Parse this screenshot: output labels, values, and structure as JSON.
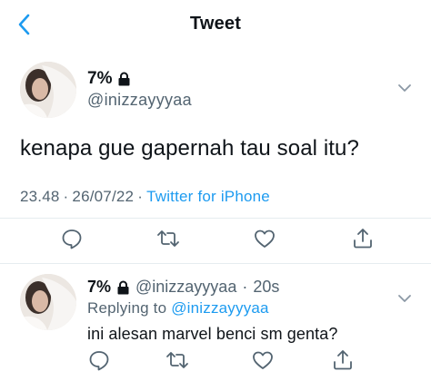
{
  "header": {
    "title": "Tweet"
  },
  "tweet": {
    "author_name": "7%",
    "author_handle": "@inizzayyyaa",
    "text": "kenapa gue gapernah tau soal itu?",
    "time": "23.48",
    "separator": "·",
    "date": "26/07/22",
    "source": "Twitter for iPhone"
  },
  "reply": {
    "author_name": "7%",
    "author_handle": "@inizzayyyaa",
    "age": "20s",
    "replying_prefix": "Replying to",
    "replying_to": "@inizzayyyaa",
    "text": "ini alesan marvel benci sm genta?"
  },
  "colors": {
    "accent": "#1d9bf0",
    "muted": "#536471",
    "text": "#0f1419"
  },
  "icons": [
    "back-chevron-icon",
    "lock-icon",
    "chevron-down-icon",
    "reply-icon",
    "retweet-icon",
    "like-icon",
    "share-icon"
  ]
}
